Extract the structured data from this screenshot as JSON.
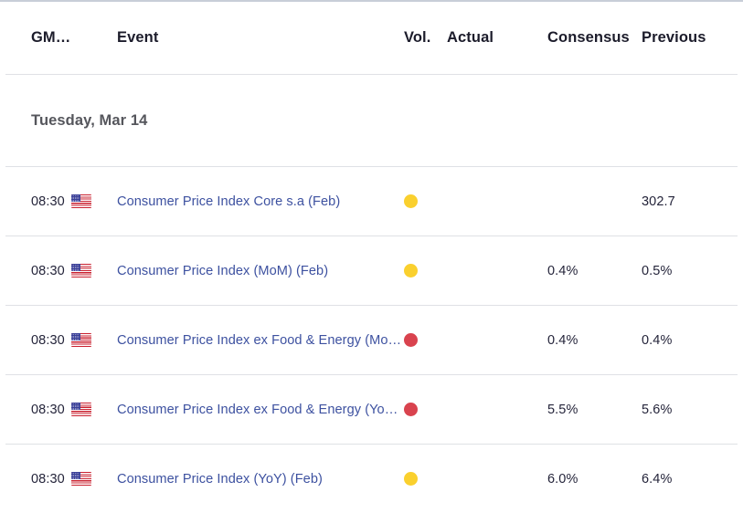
{
  "table": {
    "columns": {
      "time": "GM…",
      "event": "Event",
      "vol": "Vol.",
      "actual": "Actual",
      "consensus": "Consensus",
      "previous": "Previous"
    },
    "date_group": "Tuesday, Mar 14",
    "rows": [
      {
        "time": "08:30",
        "country": "United States",
        "flag": "us-flag-icon",
        "event": "Consumer Price Index Core s.a (Feb)",
        "volatility": "medium",
        "volatility_color": "#fad02e",
        "actual": "",
        "consensus": "",
        "previous": "302.7"
      },
      {
        "time": "08:30",
        "country": "United States",
        "flag": "us-flag-icon",
        "event": "Consumer Price Index (MoM) (Feb)",
        "volatility": "medium",
        "volatility_color": "#fad02e",
        "actual": "",
        "consensus": "0.4%",
        "previous": "0.5%"
      },
      {
        "time": "08:30",
        "country": "United States",
        "flag": "us-flag-icon",
        "event": "Consumer Price Index ex Food & Energy (MoM) (Feb)",
        "volatility": "high",
        "volatility_color": "#d9434e",
        "actual": "",
        "consensus": "0.4%",
        "previous": "0.4%"
      },
      {
        "time": "08:30",
        "country": "United States",
        "flag": "us-flag-icon",
        "event": "Consumer Price Index ex Food & Energy (YoY) (Feb)",
        "volatility": "high",
        "volatility_color": "#d9434e",
        "actual": "",
        "consensus": "5.5%",
        "previous": "5.6%"
      },
      {
        "time": "08:30",
        "country": "United States",
        "flag": "us-flag-icon",
        "event": "Consumer Price Index (YoY) (Feb)",
        "volatility": "medium",
        "volatility_color": "#fad02e",
        "actual": "",
        "consensus": "6.0%",
        "previous": "6.4%"
      }
    ]
  }
}
